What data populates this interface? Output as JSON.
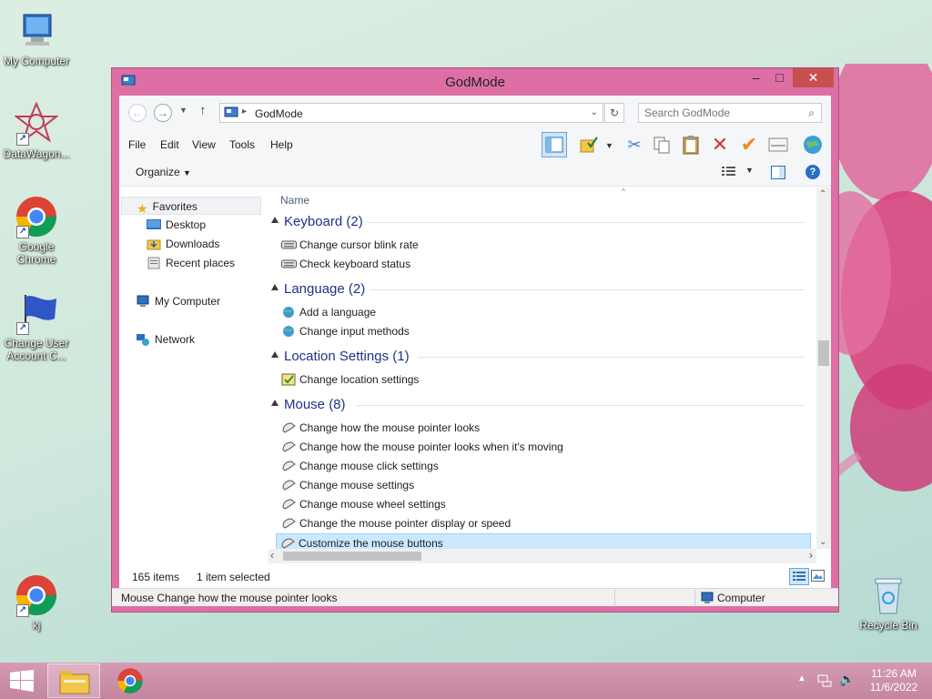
{
  "desktop": {
    "icons": [
      {
        "label": "My Computer"
      },
      {
        "label": "DataWagon..."
      },
      {
        "label": "Google Chrome"
      },
      {
        "label": "Change User Account C..."
      },
      {
        "label": "kj"
      },
      {
        "label": "Recycle Bin"
      }
    ]
  },
  "window": {
    "title": "GodMode",
    "min_glyph": "–",
    "max_glyph": "□",
    "close_glyph": "✕"
  },
  "address": {
    "path": "GodMode",
    "search_placeholder": "Search GodMode"
  },
  "menu": {
    "items": [
      "File",
      "Edit",
      "View",
      "Tools",
      "Help"
    ]
  },
  "commandbar": {
    "organize": "Organize"
  },
  "nav": {
    "favorites": "Favorites",
    "desktop": "Desktop",
    "downloads": "Downloads",
    "recent": "Recent places",
    "computer": "My Computer",
    "network": "Network"
  },
  "content": {
    "column_name": "Name",
    "groups": [
      {
        "title": "Keyboard (2)",
        "items": [
          "Change cursor blink rate",
          "Check keyboard status"
        ]
      },
      {
        "title": "Language (2)",
        "items": [
          "Add a language",
          "Change input methods"
        ]
      },
      {
        "title": "Location Settings (1)",
        "items": [
          "Change location settings"
        ]
      },
      {
        "title": "Mouse (8)",
        "items": [
          "Change how the mouse pointer looks",
          "Change how the mouse pointer looks when it's moving",
          "Change mouse click settings",
          "Change mouse settings",
          "Change mouse wheel settings",
          "Change the mouse pointer display or speed",
          "Customize the mouse buttons"
        ]
      }
    ]
  },
  "status": {
    "count": "165 items",
    "selected": "1 item selected",
    "detail": "Mouse Change how the mouse pointer looks",
    "location": "Computer"
  },
  "tray": {
    "time": "11:26 AM",
    "date": "11/6/2022"
  },
  "colors": {
    "window_frame": "#dd6fa5",
    "selection": "#cce8ff",
    "group_header": "#1e3287",
    "taskbar": "#c98fa8"
  }
}
